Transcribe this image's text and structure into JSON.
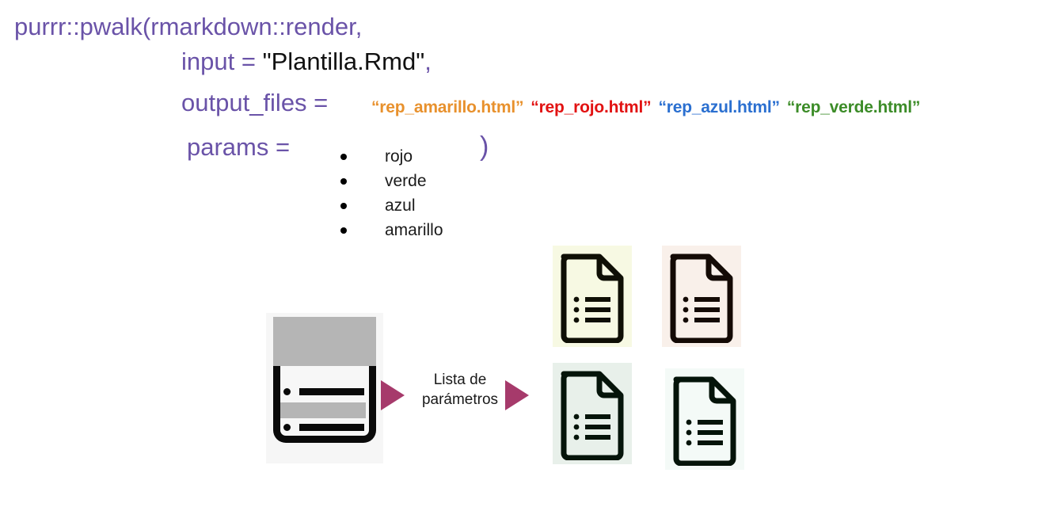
{
  "code": {
    "line1": "purrr::pwalk(rmarkdown::render,",
    "line2_key": "input = ",
    "line2_value": "\"Plantilla.Rmd\"",
    "line2_comma": ",",
    "line3_key": "output_files = ",
    "line4_key": "params =",
    "closing_paren": ")",
    "output_files": [
      {
        "name": "“rep_amarillo.html”",
        "color": "#e8912d"
      },
      {
        "name": "“rep_rojo.html”",
        "color": "#e21212"
      },
      {
        "name": "“rep_azul.html”",
        "color": "#2a6fd0"
      },
      {
        "name": "“rep_verde.html”",
        "color": "#3c8c28"
      }
    ]
  },
  "params": {
    "items": [
      {
        "label": "rojo"
      },
      {
        "label": "verde"
      },
      {
        "label": "azul"
      },
      {
        "label": "amarillo"
      }
    ]
  },
  "diagram": {
    "template_icon_name": "clipboard-template",
    "arrow_label_line1": "Lista de",
    "arrow_label_line2": "parámetros",
    "arrow_color": "#a63a6b",
    "documents": [
      {
        "name": "report-amarillo",
        "tint": "#f7f9e3",
        "outline": "#0f0f05"
      },
      {
        "name": "report-rojo",
        "tint": "#f9f0ea",
        "outline": "#140a05"
      },
      {
        "name": "report-verde",
        "tint": "#e8f0ea",
        "outline": "#05140a"
      },
      {
        "name": "report-azul",
        "tint": "#f4faf7",
        "outline": "#05140a"
      }
    ]
  },
  "colors": {
    "code_purple": "#6a53a8",
    "string_black": "#111111",
    "background": "#ffffff"
  }
}
